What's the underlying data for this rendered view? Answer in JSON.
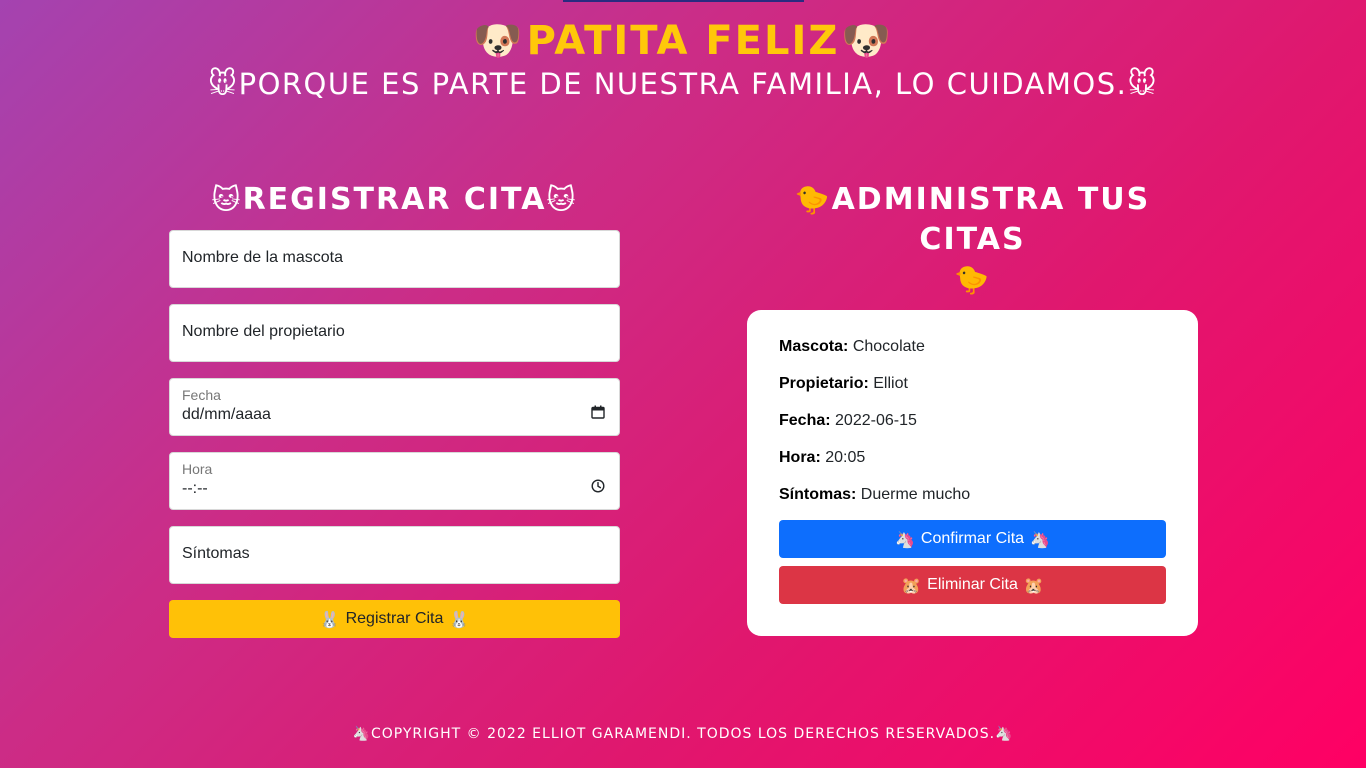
{
  "header": {
    "title": "PATITA FELIZ",
    "title_icon": "🐶",
    "tagline": "PORQUE ES PARTE DE NUESTRA FAMILIA, LO CUIDAMOS.",
    "tagline_icon": "🐭",
    "title_color": "#ffc80a"
  },
  "register": {
    "title": "REGISTRAR CITA",
    "title_icon": "🐱",
    "pet_placeholder": "Nombre de la mascota",
    "owner_placeholder": "Nombre del propietario",
    "date_label": "Fecha",
    "date_value": "dd/mm/aaaa",
    "time_label": "Hora",
    "time_value": "--:--",
    "symptoms_placeholder": "Síntomas",
    "submit_label": "Registrar Cita",
    "submit_icon": "🐰"
  },
  "manage": {
    "title": "ADMINISTRA TUS CITAS",
    "title_icon": "🐤",
    "appointment": {
      "pet_label": "Mascota:",
      "pet_value": "Chocolate",
      "owner_label": "Propietario:",
      "owner_value": "Elliot",
      "date_label": "Fecha:",
      "date_value": "2022-06-15",
      "time_label": "Hora:",
      "time_value": "20:05",
      "symptoms_label": "Síntomas:",
      "symptoms_value": "Duerme mucho"
    },
    "confirm_label": "Confirmar Cita",
    "confirm_icon": "🦄",
    "delete_label": "Eliminar Cita",
    "delete_icon": "🐹"
  },
  "footer": {
    "icon": "🦄",
    "text": "COPYRIGHT © 2022 ELLIOT GARAMENDI. TODOS LOS DERECHOS RESERVADOS."
  },
  "colors": {
    "gradient_start": "#a443b0",
    "gradient_end": "#ff0064",
    "yellow_button": "#ffc107",
    "blue_button": "#0d6efd",
    "red_button": "#dc3545"
  }
}
